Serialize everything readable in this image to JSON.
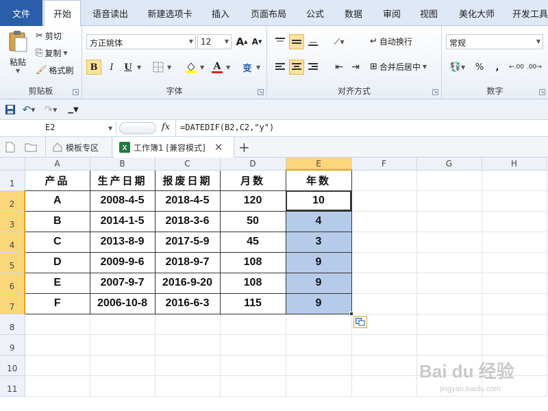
{
  "tabs": [
    "文件",
    "开始",
    "语音读出",
    "新建选项卡",
    "插入",
    "页面布局",
    "公式",
    "数据",
    "审阅",
    "视图",
    "美化大师",
    "开发工具"
  ],
  "active_tab": "开始",
  "clipboard": {
    "paste": "粘贴",
    "cut": "剪切",
    "copy": "复制",
    "format_painter": "格式刷",
    "label": "剪贴板"
  },
  "font": {
    "name": "方正姚体",
    "size": "12",
    "label": "字体",
    "bold": "B",
    "italic": "I",
    "underline": "U",
    "grow": "A",
    "shrink": "A",
    "font_color_letter": "A",
    "wen": "变"
  },
  "alignment": {
    "wrap_text": "自动换行",
    "merge_center": "合并后居中",
    "label": "对齐方式"
  },
  "number": {
    "format": "常规",
    "label": "数字",
    "percent": "%",
    "comma": ",",
    "inc_decimal": ".00",
    "dec_decimal": ".00"
  },
  "formula_bar": {
    "cell_ref": "E2",
    "fx": "fx",
    "formula": "=DATEDIF(B2,C2,\"y\")"
  },
  "doc_tabs": {
    "template": "模板专区",
    "workbook": "工作簿1 [兼容模式]"
  },
  "sheet": {
    "columns": [
      "A",
      "B",
      "C",
      "D",
      "E",
      "F",
      "G",
      "H"
    ],
    "rows": [
      "1",
      "2",
      "3",
      "4",
      "5",
      "6",
      "7",
      "8",
      "9",
      "10",
      "11"
    ],
    "header": [
      "产品",
      "生产日期",
      "报废日期",
      "月数",
      "年数"
    ],
    "data": [
      [
        "A",
        "2008-4-5",
        "2018-4-5",
        "120",
        "10"
      ],
      [
        "B",
        "2014-1-5",
        "2018-3-6",
        "50",
        "4"
      ],
      [
        "C",
        "2013-8-9",
        "2017-5-9",
        "45",
        "3"
      ],
      [
        "D",
        "2009-9-6",
        "2018-9-7",
        "108",
        "9"
      ],
      [
        "E",
        "2007-9-7",
        "2016-9-20",
        "108",
        "9"
      ],
      [
        "F",
        "2006-10-8",
        "2016-6-3",
        "115",
        "9"
      ]
    ],
    "selected_column": "E",
    "active_cell": "E2"
  },
  "watermark": {
    "brand": "Bai du 经验",
    "url": "jingyan.baidu.com"
  },
  "colors": {
    "accent": "#2a5ea8",
    "selection": "#b6cbe9",
    "header_highlight": "#fbd77a"
  }
}
